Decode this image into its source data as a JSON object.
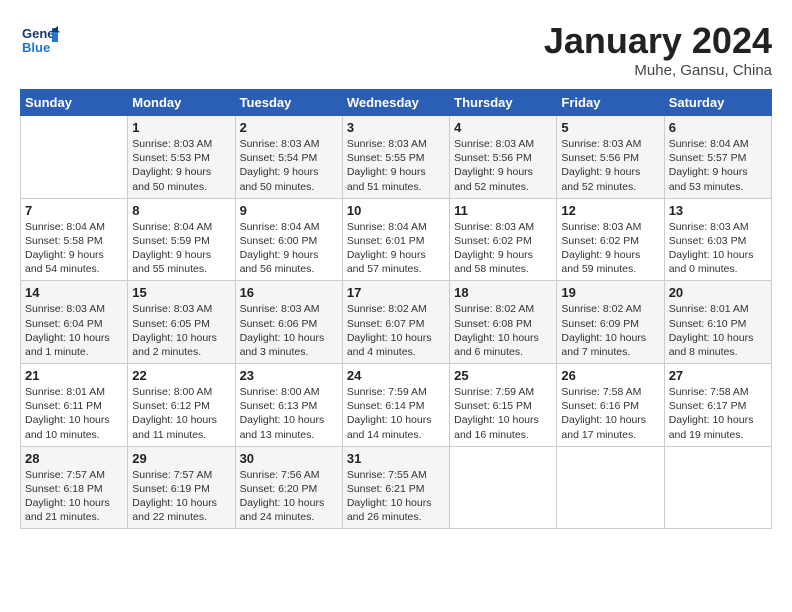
{
  "header": {
    "logo_general": "General",
    "logo_blue": "Blue",
    "month_title": "January 2024",
    "subtitle": "Muhe, Gansu, China"
  },
  "columns": [
    "Sunday",
    "Monday",
    "Tuesday",
    "Wednesday",
    "Thursday",
    "Friday",
    "Saturday"
  ],
  "weeks": [
    [
      {
        "day": "",
        "info": ""
      },
      {
        "day": "1",
        "info": "Sunrise: 8:03 AM\nSunset: 5:53 PM\nDaylight: 9 hours\nand 50 minutes."
      },
      {
        "day": "2",
        "info": "Sunrise: 8:03 AM\nSunset: 5:54 PM\nDaylight: 9 hours\nand 50 minutes."
      },
      {
        "day": "3",
        "info": "Sunrise: 8:03 AM\nSunset: 5:55 PM\nDaylight: 9 hours\nand 51 minutes."
      },
      {
        "day": "4",
        "info": "Sunrise: 8:03 AM\nSunset: 5:56 PM\nDaylight: 9 hours\nand 52 minutes."
      },
      {
        "day": "5",
        "info": "Sunrise: 8:03 AM\nSunset: 5:56 PM\nDaylight: 9 hours\nand 52 minutes."
      },
      {
        "day": "6",
        "info": "Sunrise: 8:04 AM\nSunset: 5:57 PM\nDaylight: 9 hours\nand 53 minutes."
      }
    ],
    [
      {
        "day": "7",
        "info": "Sunrise: 8:04 AM\nSunset: 5:58 PM\nDaylight: 9 hours\nand 54 minutes."
      },
      {
        "day": "8",
        "info": "Sunrise: 8:04 AM\nSunset: 5:59 PM\nDaylight: 9 hours\nand 55 minutes."
      },
      {
        "day": "9",
        "info": "Sunrise: 8:04 AM\nSunset: 6:00 PM\nDaylight: 9 hours\nand 56 minutes."
      },
      {
        "day": "10",
        "info": "Sunrise: 8:04 AM\nSunset: 6:01 PM\nDaylight: 9 hours\nand 57 minutes."
      },
      {
        "day": "11",
        "info": "Sunrise: 8:03 AM\nSunset: 6:02 PM\nDaylight: 9 hours\nand 58 minutes."
      },
      {
        "day": "12",
        "info": "Sunrise: 8:03 AM\nSunset: 6:02 PM\nDaylight: 9 hours\nand 59 minutes."
      },
      {
        "day": "13",
        "info": "Sunrise: 8:03 AM\nSunset: 6:03 PM\nDaylight: 10 hours\nand 0 minutes."
      }
    ],
    [
      {
        "day": "14",
        "info": "Sunrise: 8:03 AM\nSunset: 6:04 PM\nDaylight: 10 hours\nand 1 minute."
      },
      {
        "day": "15",
        "info": "Sunrise: 8:03 AM\nSunset: 6:05 PM\nDaylight: 10 hours\nand 2 minutes."
      },
      {
        "day": "16",
        "info": "Sunrise: 8:03 AM\nSunset: 6:06 PM\nDaylight: 10 hours\nand 3 minutes."
      },
      {
        "day": "17",
        "info": "Sunrise: 8:02 AM\nSunset: 6:07 PM\nDaylight: 10 hours\nand 4 minutes."
      },
      {
        "day": "18",
        "info": "Sunrise: 8:02 AM\nSunset: 6:08 PM\nDaylight: 10 hours\nand 6 minutes."
      },
      {
        "day": "19",
        "info": "Sunrise: 8:02 AM\nSunset: 6:09 PM\nDaylight: 10 hours\nand 7 minutes."
      },
      {
        "day": "20",
        "info": "Sunrise: 8:01 AM\nSunset: 6:10 PM\nDaylight: 10 hours\nand 8 minutes."
      }
    ],
    [
      {
        "day": "21",
        "info": "Sunrise: 8:01 AM\nSunset: 6:11 PM\nDaylight: 10 hours\nand 10 minutes."
      },
      {
        "day": "22",
        "info": "Sunrise: 8:00 AM\nSunset: 6:12 PM\nDaylight: 10 hours\nand 11 minutes."
      },
      {
        "day": "23",
        "info": "Sunrise: 8:00 AM\nSunset: 6:13 PM\nDaylight: 10 hours\nand 13 minutes."
      },
      {
        "day": "24",
        "info": "Sunrise: 7:59 AM\nSunset: 6:14 PM\nDaylight: 10 hours\nand 14 minutes."
      },
      {
        "day": "25",
        "info": "Sunrise: 7:59 AM\nSunset: 6:15 PM\nDaylight: 10 hours\nand 16 minutes."
      },
      {
        "day": "26",
        "info": "Sunrise: 7:58 AM\nSunset: 6:16 PM\nDaylight: 10 hours\nand 17 minutes."
      },
      {
        "day": "27",
        "info": "Sunrise: 7:58 AM\nSunset: 6:17 PM\nDaylight: 10 hours\nand 19 minutes."
      }
    ],
    [
      {
        "day": "28",
        "info": "Sunrise: 7:57 AM\nSunset: 6:18 PM\nDaylight: 10 hours\nand 21 minutes."
      },
      {
        "day": "29",
        "info": "Sunrise: 7:57 AM\nSunset: 6:19 PM\nDaylight: 10 hours\nand 22 minutes."
      },
      {
        "day": "30",
        "info": "Sunrise: 7:56 AM\nSunset: 6:20 PM\nDaylight: 10 hours\nand 24 minutes."
      },
      {
        "day": "31",
        "info": "Sunrise: 7:55 AM\nSunset: 6:21 PM\nDaylight: 10 hours\nand 26 minutes."
      },
      {
        "day": "",
        "info": ""
      },
      {
        "day": "",
        "info": ""
      },
      {
        "day": "",
        "info": ""
      }
    ]
  ]
}
